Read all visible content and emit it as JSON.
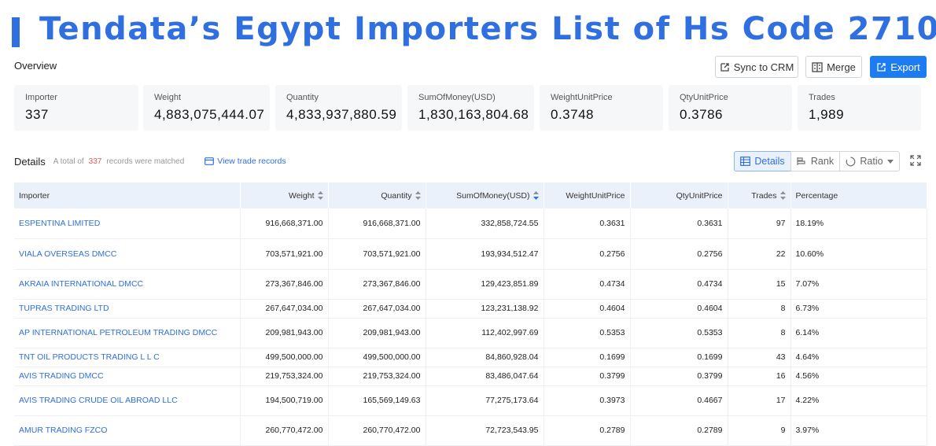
{
  "title": "Tendata’s Egypt Importers List of Hs Code 2710",
  "overview_label": "Overview",
  "toolbar": {
    "sync_label": "Sync to CRM",
    "merge_label": "Merge",
    "export_label": "Export"
  },
  "stats": [
    {
      "label": "Importer",
      "value": "337"
    },
    {
      "label": "Weight",
      "value": "4,883,075,444.07"
    },
    {
      "label": "Quantity",
      "value": "4,833,937,880.59"
    },
    {
      "label": "SumOfMoney(USD)",
      "value": "1,830,163,804.68"
    },
    {
      "label": "WeightUnitPrice",
      "value": "0.3748"
    },
    {
      "label": "QtyUnitPrice",
      "value": "0.3786"
    },
    {
      "label": "Trades",
      "value": "1,989"
    }
  ],
  "details": {
    "title": "Details",
    "total_prefix": "A total of",
    "count": "337",
    "total_suffix": "records were matched",
    "view_trade_records": "View trade records"
  },
  "view_tabs": {
    "details": "Details",
    "rank": "Rank",
    "ratio": "Ratio"
  },
  "colors": {
    "accent": "#2f6fe0",
    "primary_button": "#1e7cf2",
    "count": "#e25858",
    "header_bg": "#ebf1fb"
  },
  "table": {
    "headers": [
      "Importer",
      "Weight",
      "Quantity",
      "SumOfMoney(USD)",
      "WeightUnitPrice",
      "QtyUnitPrice",
      "Trades",
      "Percentage"
    ],
    "rows": [
      [
        "ESPENTINA LIMITED",
        "916,668,371.00",
        "916,668,371.00",
        "332,858,724.55",
        "0.3631",
        "0.3631",
        "97",
        "18.19%"
      ],
      [
        "VIALA OVERSEAS DMCC",
        "703,571,921.00",
        "703,571,921.00",
        "193,934,512.47",
        "0.2756",
        "0.2756",
        "22",
        "10.60%"
      ],
      [
        "AKRAIA INTERNATIONAL DMCC",
        "273,367,846.00",
        "273,367,846.00",
        "129,423,851.89",
        "0.4734",
        "0.4734",
        "15",
        "7.07%"
      ],
      [
        "TUPRAS TRADING LTD",
        "267,647,034.00",
        "267,647,034.00",
        "123,231,138.92",
        "0.4604",
        "0.4604",
        "8",
        "6.73%"
      ],
      [
        "AP INTERNATIONAL PETROLEUM TRADING DMCC",
        "209,981,943.00",
        "209,981,943.00",
        "112,402,997.69",
        "0.5353",
        "0.5353",
        "8",
        "6.14%"
      ],
      [
        "TNT OIL PRODUCTS TRADING L L C",
        "499,500,000.00",
        "499,500,000.00",
        "84,860,928.04",
        "0.1699",
        "0.1699",
        "43",
        "4.64%"
      ],
      [
        "AVIS TRADING DMCC",
        "219,753,324.00",
        "219,753,324.00",
        "83,486,047.64",
        "0.3799",
        "0.3799",
        "16",
        "4.56%"
      ],
      [
        "AVIS TRADING CRUDE OIL ABROAD LLC",
        "194,500,719.00",
        "165,569,149.63",
        "77,275,173.64",
        "0.3973",
        "0.4667",
        "17",
        "4.22%"
      ],
      [
        "AMUR TRADING FZCO",
        "260,770,472.00",
        "260,770,472.00",
        "72,723,543.95",
        "0.2789",
        "0.2789",
        "9",
        "3.97%"
      ]
    ]
  }
}
